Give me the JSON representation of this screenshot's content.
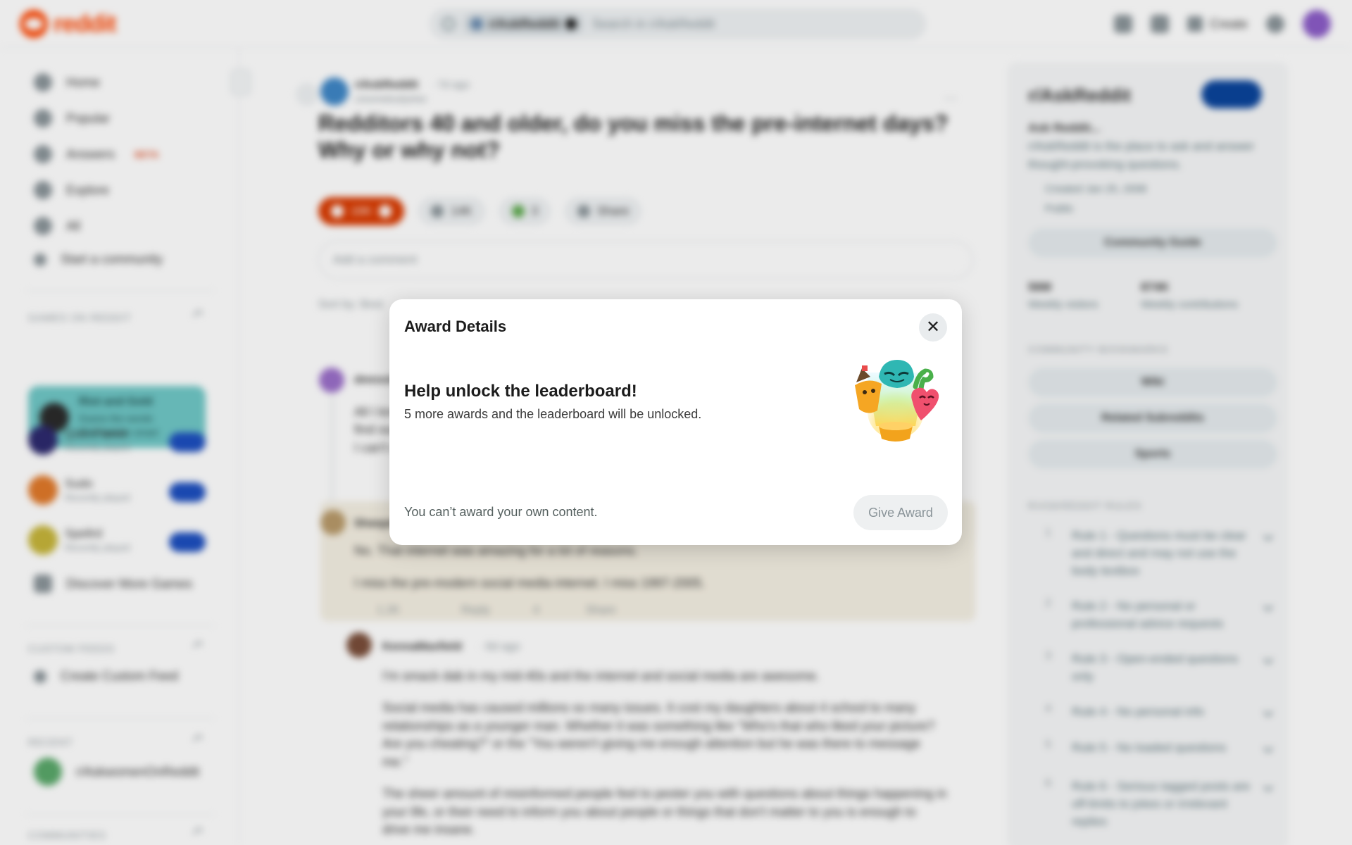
{
  "app": {
    "brand": "reddit"
  },
  "topbar": {
    "search_chip": "r/AskReddit",
    "search_placeholder": "Search in r/AskReddit",
    "create_label": "Create"
  },
  "leftnav": {
    "items": [
      {
        "label": "Home"
      },
      {
        "label": "Popular"
      },
      {
        "label": "Answers",
        "badge": "BETA"
      },
      {
        "label": "Explore"
      },
      {
        "label": "All"
      },
      {
        "label": "Start a community"
      }
    ],
    "games_header": "GAMES ON REDDIT",
    "promo": {
      "title": "Riot and Gold",
      "line1": "Guess the words",
      "line2": "Play and be smart"
    },
    "games": [
      {
        "name": "Quiz Planet",
        "sub": "Recently played"
      },
      {
        "name": "Sudo",
        "sub": "Recently played"
      },
      {
        "name": "Spellrd",
        "sub": "Recently played"
      }
    ],
    "discover": "Discover More Games",
    "feeds_header": "CUSTOM FEEDS",
    "create_feed": "Create Custom Feed",
    "recent_header": "RECENT",
    "recent_item": "r/AskwomenOnReddit",
    "communities_header": "COMMUNITIES"
  },
  "post": {
    "subreddit": "r/AskReddit",
    "time": "· 7d ago",
    "user": "u/somebodyelse",
    "title": "Redditors 40 and older, do you miss the pre-internet days? Why or why not?",
    "upvotes": "16K",
    "comments": "14K",
    "awards": "3",
    "share": "Share",
    "comment_placeholder": "Add a comment",
    "sort": "Sort by: Best"
  },
  "comments": [
    {
      "name": "dmnxxbb",
      "lines": [
        "All I know is that I had to wait all week to",
        "find out what happened in the show.",
        "I can't say I miss it."
      ]
    },
    {
      "name": "Sheepdog",
      "lines": [
        "No. That internet was amazing for a lot of reasons.",
        "I miss the pre-modern social media internet. I miss 1997-2005."
      ],
      "score": "1.2K",
      "reply": "Reply",
      "awards": "4",
      "share": "Share"
    },
    {
      "name": "KennaMaxfield",
      "time": "· 6d ago",
      "lines": [
        "I'm smack dab in my mid-40s and the internet and social media are awesome.",
        "Social media has caused millions so many issues. It cost my daughters about 4 school to many",
        "relationships as a younger man. Whether it was something like \"Who's that who liked your picture?",
        "Are you cheating?\" or the \"You weren't giving me enough attention but he was there to message",
        "me.\"",
        "The sheer amount of misinformed people feel to pester you with questions about things happening in",
        "your life, or their need to inform you about people or things that don't matter to you is enough to",
        "drive me insane."
      ]
    }
  ],
  "sidebar": {
    "title": "r/AskReddit",
    "about_title": "Ask Reddit...",
    "about_lines": [
      "r/AskReddit is the place to ask and answer",
      "thought-provoking questions."
    ],
    "created": "Created Jan 25, 2008",
    "visibility": "Public",
    "guide_btn": "Community Guide",
    "stats": [
      {
        "value": "56M",
        "label": "Weekly visitors"
      },
      {
        "value": "874K",
        "label": "Weekly contributions"
      }
    ],
    "bookmarks_header": "COMMUNITY BOOKMARKS",
    "bookmarks": [
      "Wiki",
      "Related Subreddits",
      "Sports"
    ],
    "rules_header": "R/ASKREDDIT RULES",
    "rules": [
      {
        "n": "1",
        "text": "Rule 1 - Questions must be clear and direct and may not use the body textbox"
      },
      {
        "n": "2",
        "text": "Rule 2 - No personal or professional advice requests"
      },
      {
        "n": "3",
        "text": "Rule 3 - Open-ended questions only"
      },
      {
        "n": "4",
        "text": "Rule 4 - No personal info"
      },
      {
        "n": "5",
        "text": "Rule 5 - No loaded questions"
      },
      {
        "n": "6",
        "text": "Rule 6 - Serious tagged posts are off-limits to jokes or irrelevant replies"
      }
    ]
  },
  "modal": {
    "title": "Award Details",
    "close_icon": "close-icon",
    "heading": "Help unlock the leaderboard!",
    "body": "5 more awards and the leaderboard will be unlocked.",
    "illustration_icon": "award-characters-illustration",
    "note": "You can’t award your own content.",
    "give_button": "Give Award"
  }
}
